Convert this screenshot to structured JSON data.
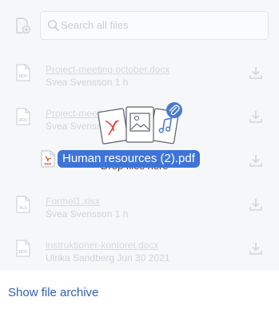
{
  "search": {
    "placeholder": "Search all files"
  },
  "files": [
    {
      "name": "Project-meeting october.docx",
      "meta": "Svea Svensson 1 h",
      "type_label": "DOC"
    },
    {
      "name": "Project-meeting october.docx",
      "meta": "Svea Svensson 1 h",
      "type_label": "DOC"
    },
    {
      "name": "Human resources (2).pdf",
      "meta": "",
      "type_label": "PDF"
    },
    {
      "name": "Formel1.xlsx",
      "meta": "Svea Svensson 1 h",
      "type_label": "XLS"
    },
    {
      "name": "instruktioner-kontoret.docx",
      "meta": "Ulrika Sandberg Jun 30 2021",
      "type_label": "DOC"
    }
  ],
  "drop": {
    "text": "Drop files here"
  },
  "drag": {
    "filename": "Human resources (2).pdf",
    "type_label": "PDF"
  },
  "footer": {
    "archive_link": "Show file archive"
  },
  "colors": {
    "accent": "#3e74d8",
    "link": "#2f5fb1",
    "pdf_red": "#e0443c",
    "badge": "#4a78d0"
  }
}
